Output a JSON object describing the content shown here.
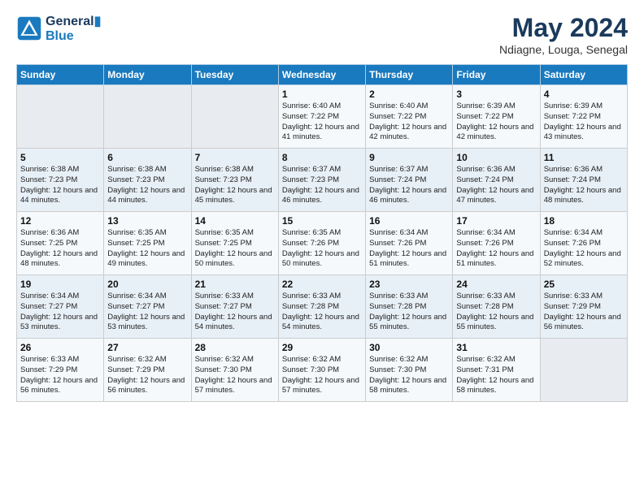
{
  "header": {
    "logo_line1": "General",
    "logo_line2": "Blue",
    "month_title": "May 2024",
    "location": "Ndiagne, Louga, Senegal"
  },
  "days_of_week": [
    "Sunday",
    "Monday",
    "Tuesday",
    "Wednesday",
    "Thursday",
    "Friday",
    "Saturday"
  ],
  "weeks": [
    [
      {
        "day": "",
        "sunrise": "",
        "sunset": "",
        "daylight": ""
      },
      {
        "day": "",
        "sunrise": "",
        "sunset": "",
        "daylight": ""
      },
      {
        "day": "",
        "sunrise": "",
        "sunset": "",
        "daylight": ""
      },
      {
        "day": "1",
        "sunrise": "Sunrise: 6:40 AM",
        "sunset": "Sunset: 7:22 PM",
        "daylight": "Daylight: 12 hours and 41 minutes."
      },
      {
        "day": "2",
        "sunrise": "Sunrise: 6:40 AM",
        "sunset": "Sunset: 7:22 PM",
        "daylight": "Daylight: 12 hours and 42 minutes."
      },
      {
        "day": "3",
        "sunrise": "Sunrise: 6:39 AM",
        "sunset": "Sunset: 7:22 PM",
        "daylight": "Daylight: 12 hours and 42 minutes."
      },
      {
        "day": "4",
        "sunrise": "Sunrise: 6:39 AM",
        "sunset": "Sunset: 7:22 PM",
        "daylight": "Daylight: 12 hours and 43 minutes."
      }
    ],
    [
      {
        "day": "5",
        "sunrise": "Sunrise: 6:38 AM",
        "sunset": "Sunset: 7:23 PM",
        "daylight": "Daylight: 12 hours and 44 minutes."
      },
      {
        "day": "6",
        "sunrise": "Sunrise: 6:38 AM",
        "sunset": "Sunset: 7:23 PM",
        "daylight": "Daylight: 12 hours and 44 minutes."
      },
      {
        "day": "7",
        "sunrise": "Sunrise: 6:38 AM",
        "sunset": "Sunset: 7:23 PM",
        "daylight": "Daylight: 12 hours and 45 minutes."
      },
      {
        "day": "8",
        "sunrise": "Sunrise: 6:37 AM",
        "sunset": "Sunset: 7:23 PM",
        "daylight": "Daylight: 12 hours and 46 minutes."
      },
      {
        "day": "9",
        "sunrise": "Sunrise: 6:37 AM",
        "sunset": "Sunset: 7:24 PM",
        "daylight": "Daylight: 12 hours and 46 minutes."
      },
      {
        "day": "10",
        "sunrise": "Sunrise: 6:36 AM",
        "sunset": "Sunset: 7:24 PM",
        "daylight": "Daylight: 12 hours and 47 minutes."
      },
      {
        "day": "11",
        "sunrise": "Sunrise: 6:36 AM",
        "sunset": "Sunset: 7:24 PM",
        "daylight": "Daylight: 12 hours and 48 minutes."
      }
    ],
    [
      {
        "day": "12",
        "sunrise": "Sunrise: 6:36 AM",
        "sunset": "Sunset: 7:25 PM",
        "daylight": "Daylight: 12 hours and 48 minutes."
      },
      {
        "day": "13",
        "sunrise": "Sunrise: 6:35 AM",
        "sunset": "Sunset: 7:25 PM",
        "daylight": "Daylight: 12 hours and 49 minutes."
      },
      {
        "day": "14",
        "sunrise": "Sunrise: 6:35 AM",
        "sunset": "Sunset: 7:25 PM",
        "daylight": "Daylight: 12 hours and 50 minutes."
      },
      {
        "day": "15",
        "sunrise": "Sunrise: 6:35 AM",
        "sunset": "Sunset: 7:26 PM",
        "daylight": "Daylight: 12 hours and 50 minutes."
      },
      {
        "day": "16",
        "sunrise": "Sunrise: 6:34 AM",
        "sunset": "Sunset: 7:26 PM",
        "daylight": "Daylight: 12 hours and 51 minutes."
      },
      {
        "day": "17",
        "sunrise": "Sunrise: 6:34 AM",
        "sunset": "Sunset: 7:26 PM",
        "daylight": "Daylight: 12 hours and 51 minutes."
      },
      {
        "day": "18",
        "sunrise": "Sunrise: 6:34 AM",
        "sunset": "Sunset: 7:26 PM",
        "daylight": "Daylight: 12 hours and 52 minutes."
      }
    ],
    [
      {
        "day": "19",
        "sunrise": "Sunrise: 6:34 AM",
        "sunset": "Sunset: 7:27 PM",
        "daylight": "Daylight: 12 hours and 53 minutes."
      },
      {
        "day": "20",
        "sunrise": "Sunrise: 6:34 AM",
        "sunset": "Sunset: 7:27 PM",
        "daylight": "Daylight: 12 hours and 53 minutes."
      },
      {
        "day": "21",
        "sunrise": "Sunrise: 6:33 AM",
        "sunset": "Sunset: 7:27 PM",
        "daylight": "Daylight: 12 hours and 54 minutes."
      },
      {
        "day": "22",
        "sunrise": "Sunrise: 6:33 AM",
        "sunset": "Sunset: 7:28 PM",
        "daylight": "Daylight: 12 hours and 54 minutes."
      },
      {
        "day": "23",
        "sunrise": "Sunrise: 6:33 AM",
        "sunset": "Sunset: 7:28 PM",
        "daylight": "Daylight: 12 hours and 55 minutes."
      },
      {
        "day": "24",
        "sunrise": "Sunrise: 6:33 AM",
        "sunset": "Sunset: 7:28 PM",
        "daylight": "Daylight: 12 hours and 55 minutes."
      },
      {
        "day": "25",
        "sunrise": "Sunrise: 6:33 AM",
        "sunset": "Sunset: 7:29 PM",
        "daylight": "Daylight: 12 hours and 56 minutes."
      }
    ],
    [
      {
        "day": "26",
        "sunrise": "Sunrise: 6:33 AM",
        "sunset": "Sunset: 7:29 PM",
        "daylight": "Daylight: 12 hours and 56 minutes."
      },
      {
        "day": "27",
        "sunrise": "Sunrise: 6:32 AM",
        "sunset": "Sunset: 7:29 PM",
        "daylight": "Daylight: 12 hours and 56 minutes."
      },
      {
        "day": "28",
        "sunrise": "Sunrise: 6:32 AM",
        "sunset": "Sunset: 7:30 PM",
        "daylight": "Daylight: 12 hours and 57 minutes."
      },
      {
        "day": "29",
        "sunrise": "Sunrise: 6:32 AM",
        "sunset": "Sunset: 7:30 PM",
        "daylight": "Daylight: 12 hours and 57 minutes."
      },
      {
        "day": "30",
        "sunrise": "Sunrise: 6:32 AM",
        "sunset": "Sunset: 7:30 PM",
        "daylight": "Daylight: 12 hours and 58 minutes."
      },
      {
        "day": "31",
        "sunrise": "Sunrise: 6:32 AM",
        "sunset": "Sunset: 7:31 PM",
        "daylight": "Daylight: 12 hours and 58 minutes."
      },
      {
        "day": "",
        "sunrise": "",
        "sunset": "",
        "daylight": ""
      }
    ]
  ]
}
